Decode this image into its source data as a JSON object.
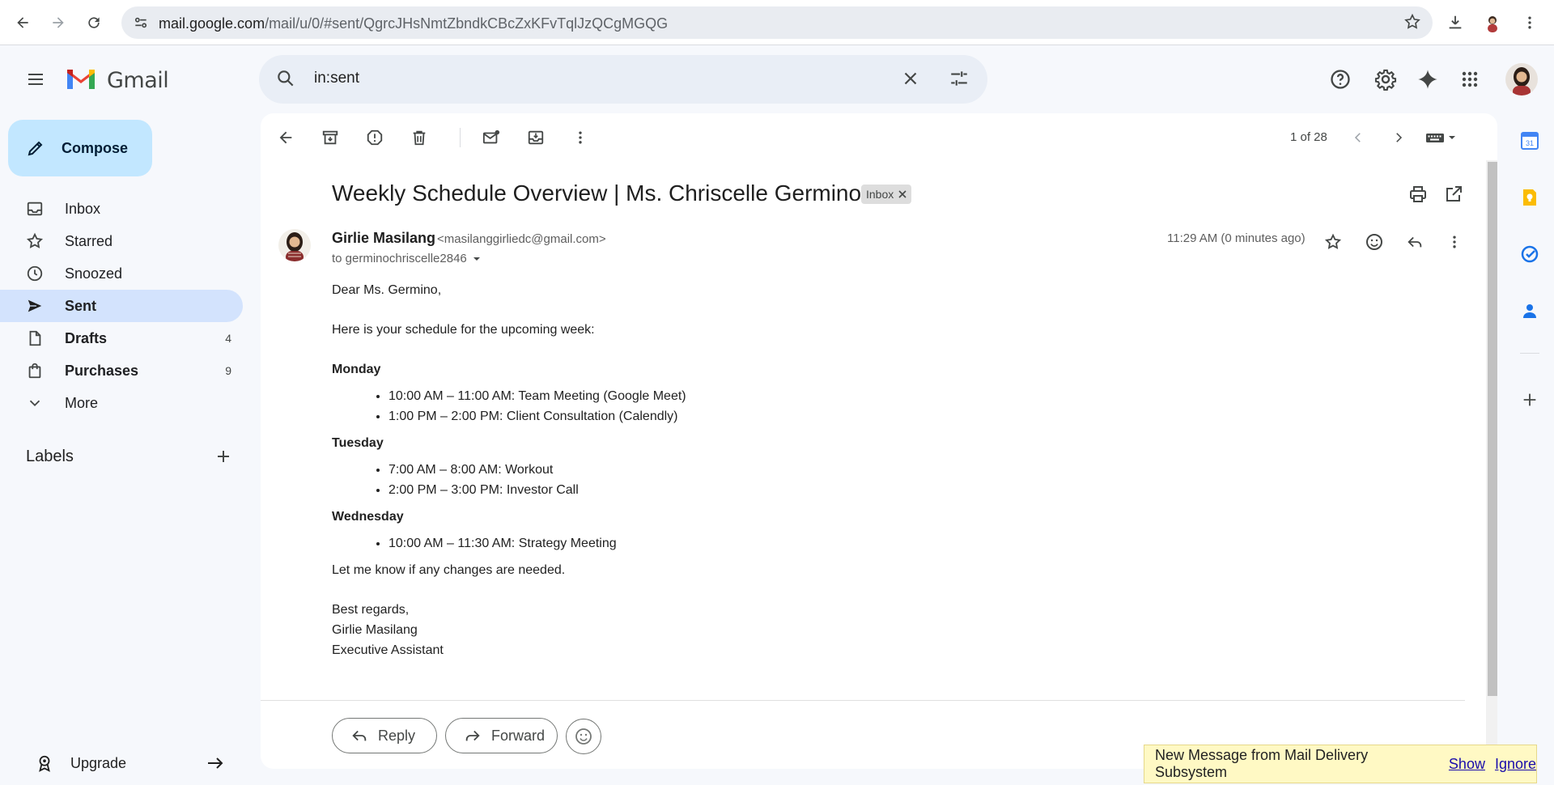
{
  "browser": {
    "url_host": "mail.google.com",
    "url_path": "/mail/u/0/#sent/QgrcJHsNmtZbndkCBcZxKFvTqlJzQCgMGQG"
  },
  "header": {
    "app_name": "Gmail",
    "search_value": "in:sent"
  },
  "sidebar": {
    "compose_label": "Compose",
    "items": [
      {
        "label": "Inbox",
        "icon": "inbox-icon",
        "count": ""
      },
      {
        "label": "Starred",
        "icon": "star-icon",
        "count": ""
      },
      {
        "label": "Snoozed",
        "icon": "clock-icon",
        "count": ""
      },
      {
        "label": "Sent",
        "icon": "send-icon",
        "count": "",
        "active": true
      },
      {
        "label": "Drafts",
        "icon": "draft-icon",
        "count": "4"
      },
      {
        "label": "Purchases",
        "icon": "shopping-bag-icon",
        "count": "9"
      },
      {
        "label": "More",
        "icon": "chevron-down-icon",
        "count": ""
      }
    ],
    "labels_title": "Labels",
    "upgrade_label": "Upgrade"
  },
  "toolbar": {
    "pager": "1 of 28"
  },
  "email": {
    "subject": "Weekly Schedule Overview | Ms. Chriscelle Germino",
    "label_chip": "Inbox",
    "sender_name": "Girlie Masilang",
    "sender_email": "<masilanggirliedc@gmail.com>",
    "to_line": "to germinochriscelle2846",
    "time": "11:29 AM (0 minutes ago)",
    "greeting": "Dear Ms. Germino,",
    "intro": "Here is your schedule for the upcoming week:",
    "days": [
      {
        "name": "Monday",
        "items": [
          "10:00 AM – 11:00 AM: Team Meeting (Google Meet)",
          "1:00 PM – 2:00 PM: Client Consultation (Calendly)"
        ]
      },
      {
        "name": "Tuesday",
        "items": [
          "7:00 AM – 8:00 AM: Workout",
          "2:00 PM – 3:00 PM: Investor Call"
        ]
      },
      {
        "name": "Wednesday",
        "items": [
          "10:00 AM – 11:30 AM: Strategy Meeting"
        ]
      }
    ],
    "closing_line": "Let me know if any changes are needed.",
    "signoff": "Best regards,",
    "signature_name": "Girlie Masilang",
    "signature_title": "Executive Assistant"
  },
  "actions": {
    "reply_label": "Reply",
    "forward_label": "Forward"
  },
  "toast": {
    "message": "New Message from Mail Delivery Subsystem",
    "show_label": "Show",
    "ignore_label": "Ignore"
  },
  "colors": {
    "compose_bg": "#c2e7ff",
    "active_nav_bg": "#d3e3fd",
    "page_bg": "#f6f8fc",
    "toast_bg": "#fff9c4"
  }
}
